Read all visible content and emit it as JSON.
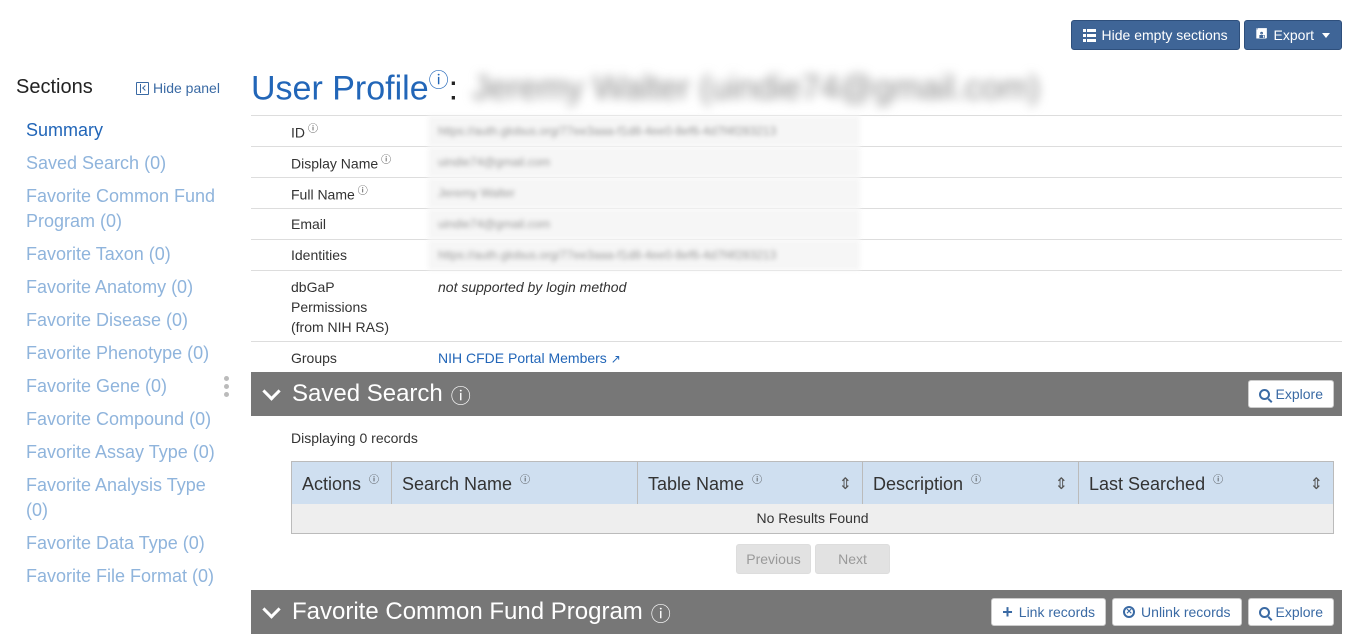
{
  "toolbar": {
    "hide_empty_label": "Hide empty sections",
    "export_label": "Export"
  },
  "sidebar": {
    "heading": "Sections",
    "hide_panel_label": "Hide panel",
    "items": [
      {
        "label": "Summary",
        "active": true
      },
      {
        "label": "Saved Search (0)"
      },
      {
        "label": "Favorite Common Fund Program (0)"
      },
      {
        "label": "Favorite Taxon (0)"
      },
      {
        "label": "Favorite Anatomy (0)"
      },
      {
        "label": "Favorite Disease (0)"
      },
      {
        "label": "Favorite Phenotype (0)"
      },
      {
        "label": "Favorite Gene (0)"
      },
      {
        "label": "Favorite Compound (0)"
      },
      {
        "label": "Favorite Assay Type (0)"
      },
      {
        "label": "Favorite Analysis Type (0)"
      },
      {
        "label": "Favorite Data Type (0)"
      },
      {
        "label": "Favorite File Format (0)"
      }
    ]
  },
  "page": {
    "title": "User Profile",
    "title_info": "ⓘ",
    "title_colon": ":",
    "title_subject": "Jeremy Walter (uindie74@gmail.com)"
  },
  "profile": {
    "rows": [
      {
        "label": "ID",
        "info": "ⓘ",
        "value": "https://auth.globus.org/77ee3aaa-f1d8-4ee0-8ef6-4d7f4f283213"
      },
      {
        "label": "Display Name",
        "info": "ⓘ",
        "value": "uindie74@gmail.com"
      },
      {
        "label": "Full Name",
        "info": "ⓘ",
        "value": "Jeremy Walter"
      },
      {
        "label": "Email",
        "info": "",
        "value": "uindie74@gmail.com"
      },
      {
        "label": "Identities",
        "info": "",
        "value": "https://auth.globus.org/77ee3aaa-f1d8-4ee0-8ef6-4d7f4f283213"
      },
      {
        "label": "dbGaP Permissions (from NIH RAS)",
        "info": "",
        "value": "not supported by login method"
      },
      {
        "label": "Groups",
        "info": "",
        "value": "NIH CFDE Portal Members"
      }
    ]
  },
  "saved_search": {
    "title": "Saved Search",
    "explore_label": "Explore",
    "displaying": "Displaying 0 records",
    "columns": [
      "Actions",
      "Search Name",
      "Table Name",
      "Description",
      "Last Searched"
    ],
    "empty_text": "No Results Found",
    "prev_label": "Previous",
    "next_label": "Next"
  },
  "favorite_cfp": {
    "title": "Favorite Common Fund Program",
    "link_label": "Link records",
    "unlink_label": "Unlink records",
    "explore_label": "Explore"
  },
  "colors": {
    "accent": "#2266b8",
    "button_dark": "#3f6597",
    "section_header": "#777777",
    "table_header": "#cfdff0"
  }
}
